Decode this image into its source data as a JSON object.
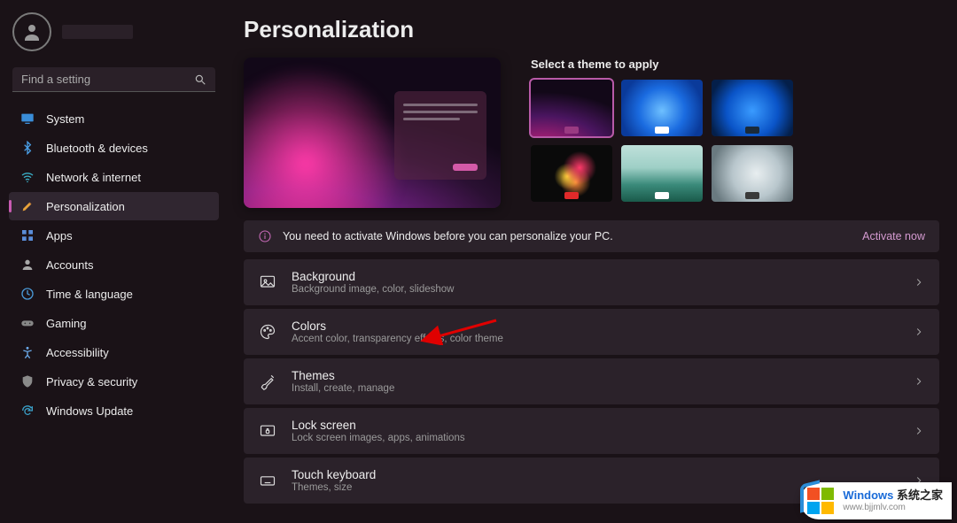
{
  "search": {
    "placeholder": "Find a setting"
  },
  "page": {
    "title": "Personalization"
  },
  "nav": [
    {
      "label": "System"
    },
    {
      "label": "Bluetooth & devices"
    },
    {
      "label": "Network & internet"
    },
    {
      "label": "Personalization"
    },
    {
      "label": "Apps"
    },
    {
      "label": "Accounts"
    },
    {
      "label": "Time & language"
    },
    {
      "label": "Gaming"
    },
    {
      "label": "Accessibility"
    },
    {
      "label": "Privacy & security"
    },
    {
      "label": "Windows Update"
    }
  ],
  "themes": {
    "heading": "Select a theme to apply"
  },
  "activation": {
    "message": "You need to activate Windows before you can personalize your PC.",
    "link": "Activate now"
  },
  "settings": [
    {
      "title": "Background",
      "sub": "Background image, color, slideshow"
    },
    {
      "title": "Colors",
      "sub": "Accent color, transparency effects, color theme"
    },
    {
      "title": "Themes",
      "sub": "Install, create, manage"
    },
    {
      "title": "Lock screen",
      "sub": "Lock screen images, apps, animations"
    },
    {
      "title": "Touch keyboard",
      "sub": "Themes, size"
    }
  ],
  "watermark": {
    "brand_a": "Windows",
    "brand_b": "系统之家",
    "url": "www.bjjmlv.com"
  }
}
